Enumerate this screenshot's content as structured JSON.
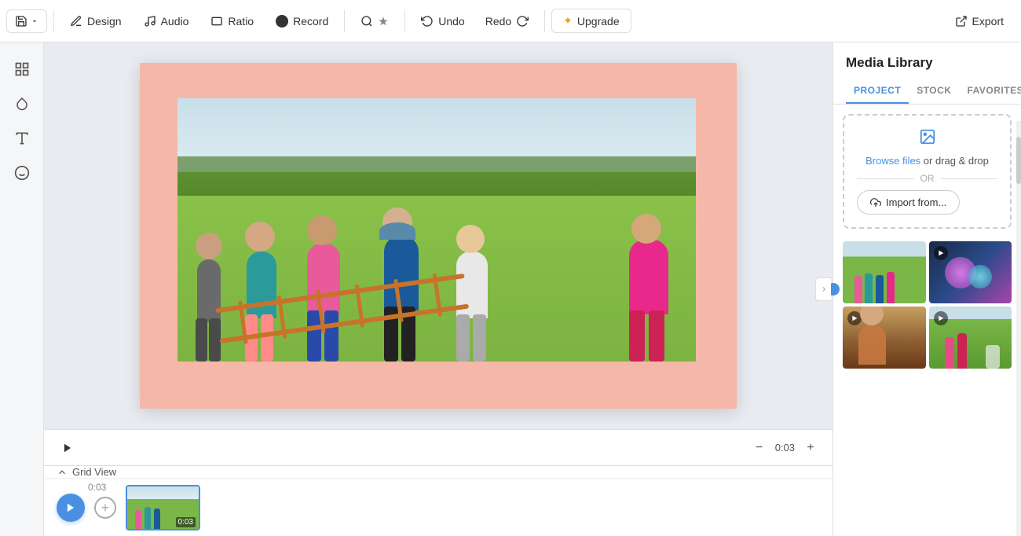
{
  "toolbar": {
    "save_label": "Save",
    "design_label": "Design",
    "audio_label": "Audio",
    "ratio_label": "Ratio",
    "record_label": "Record",
    "undo_label": "Undo",
    "redo_label": "Redo",
    "upgrade_label": "Upgrade",
    "export_label": "Export"
  },
  "left_tools": {
    "grid_label": "Grid",
    "drop_label": "Drop",
    "text_label": "Text",
    "elements_label": "Elements"
  },
  "canvas": {
    "time_display": "0:03",
    "zoom_minus": "−",
    "zoom_plus": "+"
  },
  "timeline": {
    "grid_view_label": "Grid View",
    "time_marker": "0:03",
    "clip_duration": "0:03"
  },
  "right_panel": {
    "title": "Media Library",
    "tabs": [
      "PROJECT",
      "STOCK",
      "FAVORITES"
    ],
    "upload": {
      "browse_label": "Browse files",
      "drag_label": " or drag & drop",
      "or_label": "OR",
      "import_label": "Import from..."
    },
    "media_items": [
      {
        "id": 1,
        "has_play": false,
        "color_top": "#a8c88a",
        "color_bot": "#6a9a3a"
      },
      {
        "id": 2,
        "has_play": true,
        "color_top": "#2a4a7a",
        "color_bot": "#1a3a6a"
      },
      {
        "id": 3,
        "has_play": true,
        "color_top": "#8a6a3a",
        "color_bot": "#6a4a2a"
      },
      {
        "id": 4,
        "has_play": true,
        "color_top": "#5a8a3a",
        "color_bot": "#3a6a1a"
      }
    ]
  }
}
